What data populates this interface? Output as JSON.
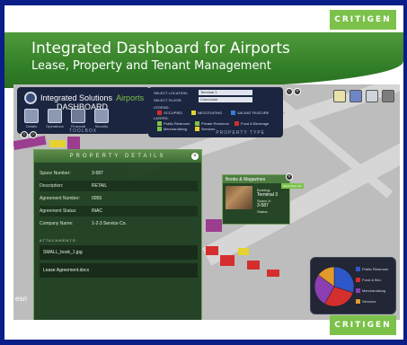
{
  "brand": {
    "top": "CRITIGEN",
    "bottom": "CRITIGEN"
  },
  "header": {
    "title": "Integrated Dashboard for Airports",
    "subtitle": "Lease, Property and Tenant Management"
  },
  "app": {
    "logo_text": "Integrated Solutions",
    "logo_product": "Airports",
    "logo_sub": "DASHBOARD",
    "toolbar_caption": "TOOLBOX",
    "tools": [
      {
        "label": "Details",
        "icon": "details-icon"
      },
      {
        "label": "Operations",
        "icon": "operations-icon"
      },
      {
        "label": "Financial",
        "icon": "financial-icon"
      },
      {
        "label": "Security",
        "icon": "security-icon"
      }
    ]
  },
  "property_type": {
    "caption": "PROPERTY TYPE",
    "select_location_label": "SELECT LOCATION:",
    "select_location_value": "Terminal 1",
    "select_floor_label": "SELECT FLOOR:",
    "select_floor_value": "Concourse",
    "legend_label": "LEGEND:",
    "layers_label": "LAYERS:",
    "legend": [
      {
        "label": "OCCUPIED",
        "color": "#d42e2e"
      },
      {
        "label": "NEGOTIATING",
        "color": "#e6d22f"
      },
      {
        "label": "VACANT FEATURE",
        "color": "#3a7bd5"
      }
    ],
    "layers": [
      {
        "label": "Public Restroom",
        "color": "#7cc24a"
      },
      {
        "label": "Private Restroom",
        "color": "#7cc24a"
      },
      {
        "label": "Food & Beverage",
        "color": "#d42e2e"
      },
      {
        "label": "Merchandising",
        "color": "#7cc24a"
      },
      {
        "label": "Services",
        "color": "#e6d22f"
      }
    ]
  },
  "details": {
    "title": "PROPERTY DETAILS",
    "close": "x",
    "rows": [
      {
        "key": "Space Number:",
        "value": "3-587"
      },
      {
        "key": "Description:",
        "value": "RETAIL"
      },
      {
        "key": "Agreement Number:",
        "value": "0055"
      },
      {
        "key": "Agreement Status:",
        "value": "INAC"
      },
      {
        "key": "Company Name:",
        "value": "1-2-3 Service Co."
      }
    ],
    "attachments_label": "ATTACHMENTS:",
    "attachments": [
      "SMALL_book_1.jpg",
      "Lease Agreement.docx"
    ]
  },
  "popup": {
    "title": "Books & Magazines",
    "tag": "Show More Info",
    "building_label": "Building:",
    "building_value": "Terminal 3",
    "space_label": "Space #:",
    "space_value": "3-587",
    "status_label": "Status:"
  },
  "pie": {
    "slices": [
      {
        "label": "Public Restroom",
        "value": 30,
        "color": "#2e58c9"
      },
      {
        "label": "Food & Bev.",
        "value": 28,
        "color": "#d42e2e"
      },
      {
        "label": "Merchandising",
        "value": 27,
        "color": "#8b3fb0"
      },
      {
        "label": "Services",
        "value": 15,
        "color": "#e29a2c"
      }
    ]
  },
  "esri": "esri"
}
